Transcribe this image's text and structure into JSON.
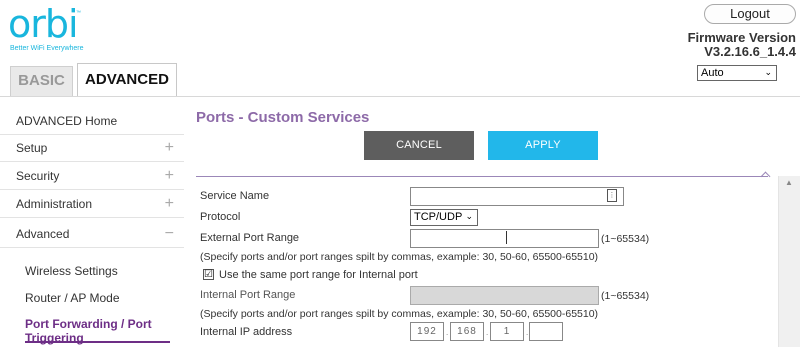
{
  "brand": {
    "logo_text": "orbi",
    "trademark": "™",
    "tagline": "Better WiFi Everywhere"
  },
  "header": {
    "logout_label": "Logout",
    "firmware_title": "Firmware Version",
    "firmware_version": "V3.2.16.6_1.4.4",
    "language_selected": "Auto",
    "tabs": [
      {
        "label": "BASIC",
        "active": false
      },
      {
        "label": "ADVANCED",
        "active": true
      }
    ]
  },
  "sidebar": {
    "items": [
      {
        "label": "ADVANCED Home",
        "toggle": ""
      },
      {
        "label": "Setup",
        "toggle": "+"
      },
      {
        "label": "Security",
        "toggle": "+"
      },
      {
        "label": "Administration",
        "toggle": "+"
      },
      {
        "label": "Advanced",
        "toggle": "−"
      }
    ],
    "subitems": [
      {
        "label": "Wireless Settings",
        "active": false
      },
      {
        "label": "Router / AP Mode",
        "active": false
      },
      {
        "label": "Port Forwarding / Port",
        "label2": "Triggering",
        "active": true
      }
    ]
  },
  "main": {
    "title": "Ports - Custom Services",
    "cancel_label": "CANCEL",
    "apply_label": "APPLY",
    "form": {
      "service_name_label": "Service Name",
      "service_name_value": "",
      "protocol_label": "Protocol",
      "protocol_value": "TCP/UDP",
      "external_port_label": "External Port Range",
      "external_port_value": "",
      "range_note": "(1~65534)",
      "hint": "(Specify ports and/or port ranges spilt by commas, example: 30, 50-60, 65500-65510)",
      "same_range_label": "Use the same port range for Internal port",
      "same_range_checked": "☑",
      "internal_port_label": "Internal Port Range",
      "internal_port_value": "",
      "internal_ip_label": "Internal IP address",
      "ip_octets": [
        "192",
        "168",
        "1",
        ""
      ],
      "ip_separator": "."
    }
  },
  "colors": {
    "brand_blue": "#19b6dd",
    "accent_purple": "#6d2e86",
    "title_purple": "#8d6aa8",
    "apply_blue": "#22b7ea",
    "cancel_gray": "#5e5e5e"
  },
  "icons": {
    "keyboard": "keyboard-icon",
    "chevron": "chevron-down-icon",
    "scroll_up": "scroll-up-arrow-icon"
  }
}
